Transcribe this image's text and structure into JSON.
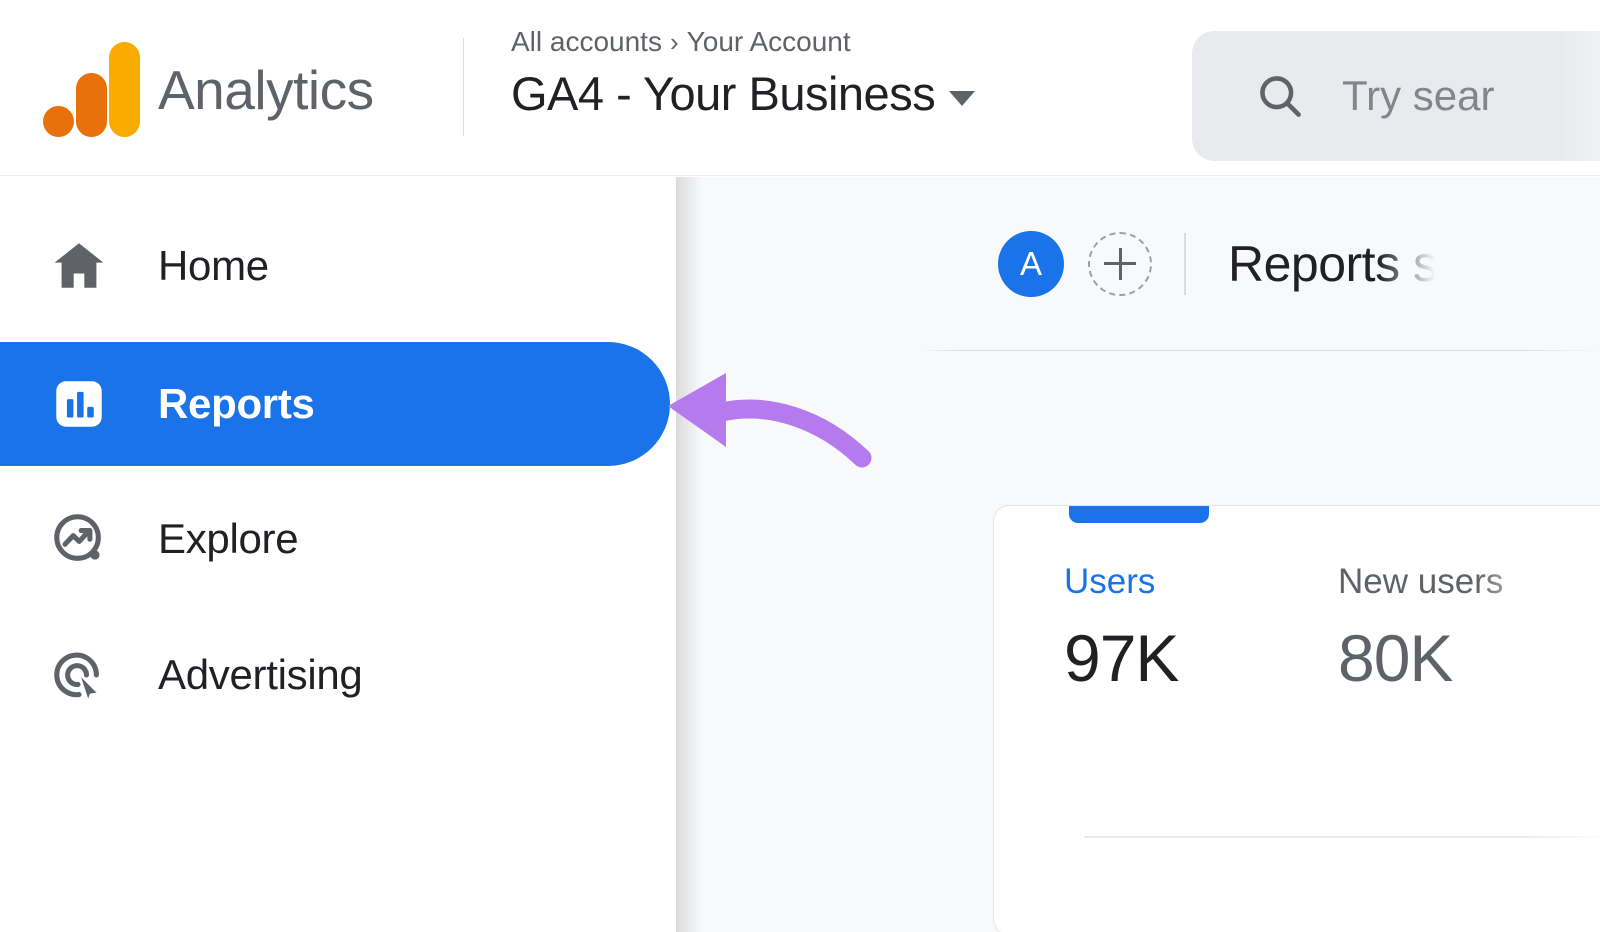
{
  "header": {
    "brand_name": "Analytics",
    "logo_icon": "google-analytics-logo",
    "breadcrumb": {
      "root": "All accounts",
      "separator": "›",
      "current": "Your Account"
    },
    "property_name": "GA4 - Your Business",
    "property_caret_icon": "chevron-down-icon",
    "search": {
      "icon": "search-icon",
      "placeholder": "Try sear"
    }
  },
  "sidebar": {
    "items": [
      {
        "label": "Home",
        "icon": "home-icon",
        "active": false
      },
      {
        "label": "Reports",
        "icon": "bar-chart-icon",
        "active": true
      },
      {
        "label": "Explore",
        "icon": "explore-trending-icon",
        "active": false
      },
      {
        "label": "Advertising",
        "icon": "ad-target-cursor-icon",
        "active": false
      }
    ]
  },
  "content": {
    "avatar_initial": "A",
    "add_button_icon": "plus-icon",
    "page_title": "Reports s",
    "card": {
      "metrics": [
        {
          "label": "Users",
          "value": "97K",
          "active": true
        },
        {
          "label": "New users",
          "value": "80K",
          "active": false
        }
      ]
    }
  },
  "annotation": {
    "arrow_icon": "curved-arrow-left-icon",
    "target": "Reports"
  },
  "colors": {
    "accent_blue": "#1a73e8",
    "logo_orange": "#E8710A",
    "logo_amber": "#F9AB00",
    "annotation_purple": "#B57BEE",
    "text_primary": "#202124",
    "text_secondary": "#5f6368",
    "content_bg": "#f8f9fa"
  }
}
